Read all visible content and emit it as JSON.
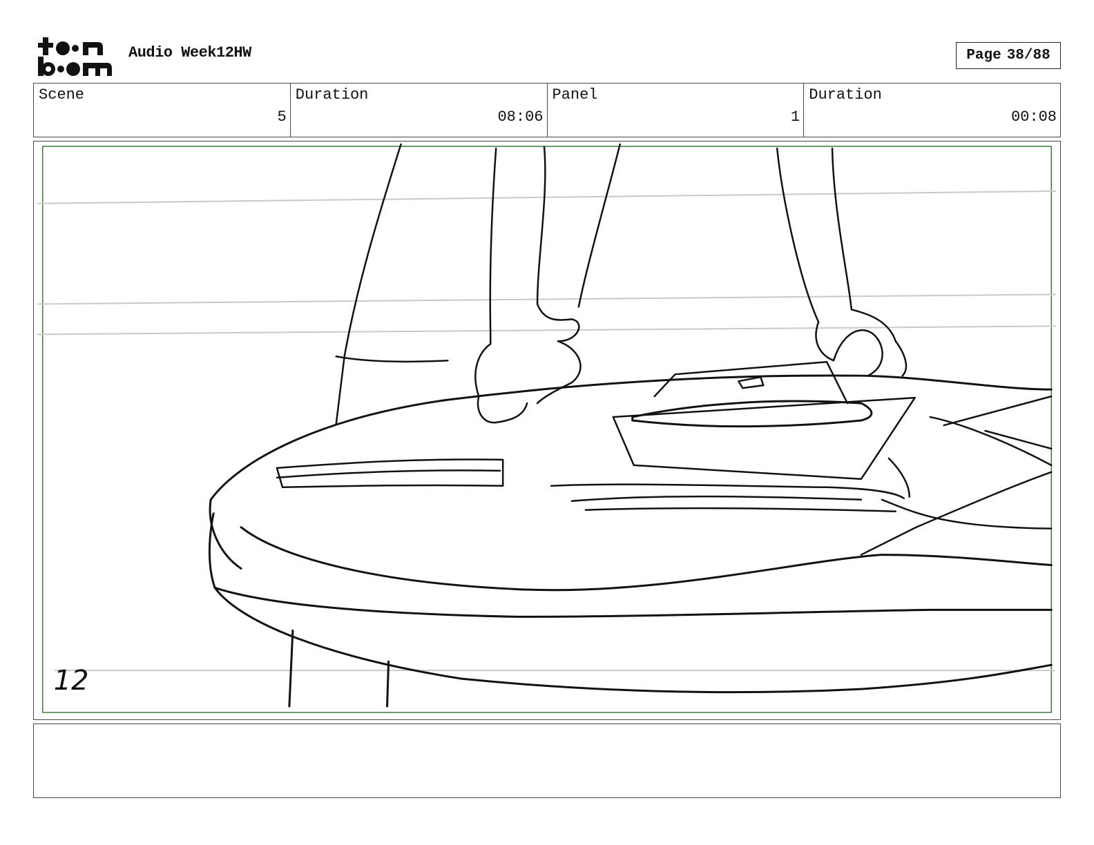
{
  "header": {
    "logo_text": "toon boom",
    "project_title": "Audio Week12HW",
    "page": {
      "label": "Page",
      "value": "38/88"
    }
  },
  "info": [
    {
      "label": "Scene",
      "value": "5"
    },
    {
      "label": "Duration",
      "value": "08:06"
    },
    {
      "label": "Panel",
      "value": "1"
    },
    {
      "label": "Duration",
      "value": "00:08"
    }
  ],
  "panel": {
    "sketch_number": "12",
    "safe_frame_color": "#3a7d3a"
  },
  "notes": {
    "text": ""
  }
}
